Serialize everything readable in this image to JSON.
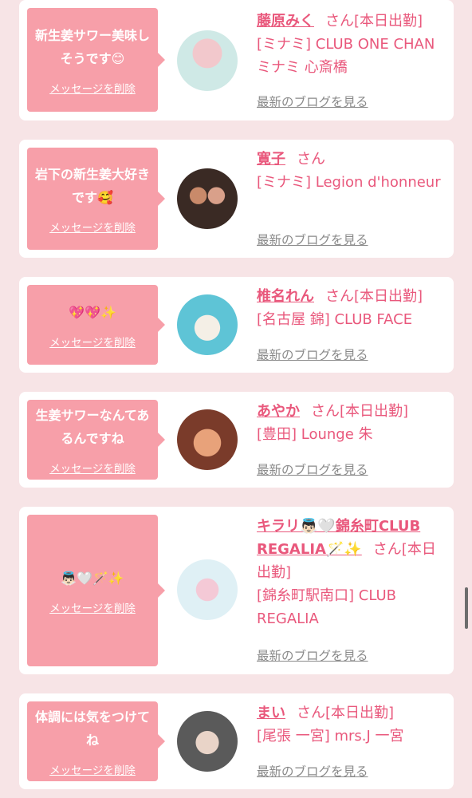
{
  "delete_label": "メッセージを削除",
  "blog_label": "最新のブログを見る",
  "san_label": "さん",
  "cards": [
    {
      "message": "新生姜サワー美味しそうです😊",
      "name": "藤原みく",
      "suffix": "[本日出勤]",
      "location": "[ミナミ] CLUB ONE CHAN ミナミ 心斎橋",
      "avatar_colors": [
        "#cfe9e6",
        "#f2c8cc"
      ]
    },
    {
      "message": "岩下の新生姜大好きです🥰",
      "name": "寛子",
      "suffix": "",
      "location": "[ミナミ] Legion d'honneur",
      "avatar_colors": [
        "#3a2a24",
        "#c98a6a"
      ]
    },
    {
      "message": "💖💖✨",
      "name": "椎名れん",
      "suffix": "[本日出勤]",
      "location": "[名古屋 錦] CLUB FACE",
      "avatar_colors": [
        "#5ec4d6",
        "#f4efe6"
      ]
    },
    {
      "message": "生姜サワーなんてあるんですね",
      "name": "あやか",
      "suffix": "[本日出勤]",
      "location": "[豊田] Lounge 朱",
      "avatar_colors": [
        "#7a3b2a",
        "#e8a27a"
      ]
    },
    {
      "message": "👼🏻🤍🪄✨",
      "name": "キラリ👼🏻🤍錦糸町CLUB REGALIA🪄✨",
      "suffix": "[本日出勤]",
      "location": "[錦糸町駅南口] CLUB REGALIA",
      "avatar_colors": [
        "#dff0f5",
        "#f4c9d6"
      ]
    },
    {
      "message": "体調には気をつけてね",
      "name": "まい",
      "suffix": "[本日出勤]",
      "location": "[尾張 一宮] mrs.J 一宮",
      "avatar_colors": [
        "#5a5a5a",
        "#e9d4c8"
      ]
    }
  ]
}
